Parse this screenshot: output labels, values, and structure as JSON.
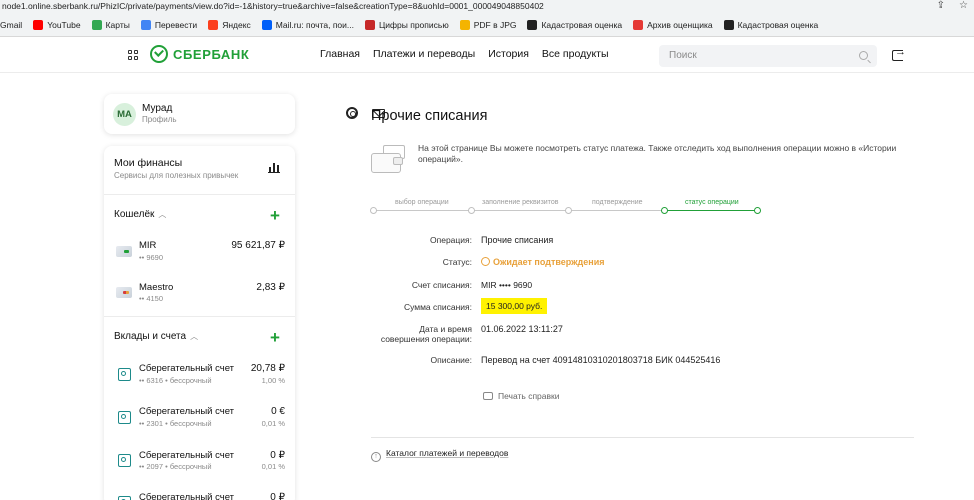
{
  "browser": {
    "url": "node1.online.sberbank.ru/PhizIC/private/payments/view.do?id=-1&history=true&archive=false&creationType=8&uohId=0001_000049048850402",
    "bookmarks": [
      {
        "label": "Gmail",
        "color": "#ea4335"
      },
      {
        "label": "YouTube",
        "color": "#ff0000"
      },
      {
        "label": "Карты",
        "color": "#34a853"
      },
      {
        "label": "Перевести",
        "color": "#4285f4"
      },
      {
        "label": "Яндекс",
        "color": "#fc3f1d"
      },
      {
        "label": "Mail.ru: почта, пои...",
        "color": "#005ff9"
      },
      {
        "label": "Цифры прописью",
        "color": "#c62828"
      },
      {
        "label": "PDF в JPG",
        "color": "#f4b400"
      },
      {
        "label": "Кадастровая оценка",
        "color": "#222222"
      },
      {
        "label": "Архив оценщика",
        "color": "#e53935"
      },
      {
        "label": "Кадастровая оценка",
        "color": "#222222"
      }
    ]
  },
  "header": {
    "logo_text": "СБЕРБАНК",
    "nav": [
      "Главная",
      "Платежи и переводы",
      "История",
      "Все продукты"
    ],
    "search_placeholder": "Поиск"
  },
  "profile": {
    "initials": "МА",
    "name": "Мурад",
    "subtitle": "Профиль"
  },
  "finances": {
    "title": "Мои финансы",
    "subtitle": "Сервисы для полезных привычек",
    "wallet_title": "Кошелёк",
    "cards": [
      {
        "name": "MIR",
        "number": "•• 9690",
        "amount": "95 621,87 ₽"
      },
      {
        "name": "Maestro",
        "number": "•• 4150",
        "amount": "2,83 ₽"
      }
    ],
    "deposits_title": "Вклады и счета",
    "deposits": [
      {
        "name": "Сберегательный счет",
        "number": "•• 6316 • бессрочный",
        "amount": "20,78 ₽",
        "rate": "1,00 %"
      },
      {
        "name": "Сберегательный счет",
        "number": "•• 2301 • бессрочный",
        "amount": "0 €",
        "rate": "0,01 %"
      },
      {
        "name": "Сберегательный счет",
        "number": "•• 2097 • бессрочный",
        "amount": "0 ₽",
        "rate": "0,01 %"
      },
      {
        "name": "Сберегательный счет",
        "number": "",
        "amount": "0 ₽",
        "rate": ""
      }
    ]
  },
  "main": {
    "title": "Прочие списания",
    "info": "На этой странице Вы можете посмотреть статус платежа. Также отследить ход выполнения операции можно в «Истории операций».",
    "steps": [
      {
        "label": "выбор операции",
        "active": false
      },
      {
        "label": "заполнение реквизитов",
        "active": false
      },
      {
        "label": "подтверждение",
        "active": false
      },
      {
        "label": "статус операции",
        "active": true
      }
    ],
    "details": {
      "operation_label": "Операция:",
      "operation_value": "Прочие списания",
      "status_label": "Статус:",
      "status_value": "Ожидает подтверждения",
      "account_label": "Счет списания:",
      "account_value": "MIR  •••• 9690",
      "sum_label": "Сумма списания:",
      "sum_value": "15 300,00 руб.",
      "date_label": "Дата и время совершения операции:",
      "date_value": "01.06.2022 13:11:27",
      "desc_label": "Описание:",
      "desc_value": "Перевод на счет 40914810310201803718 БИК 044525416"
    },
    "print_label": "Печать справки",
    "catalog_label": "Каталог платежей и переводов"
  },
  "colors": {
    "brand_green": "#21a038",
    "status_orange": "#e8a13a",
    "highlight_yellow": "#fff200"
  }
}
